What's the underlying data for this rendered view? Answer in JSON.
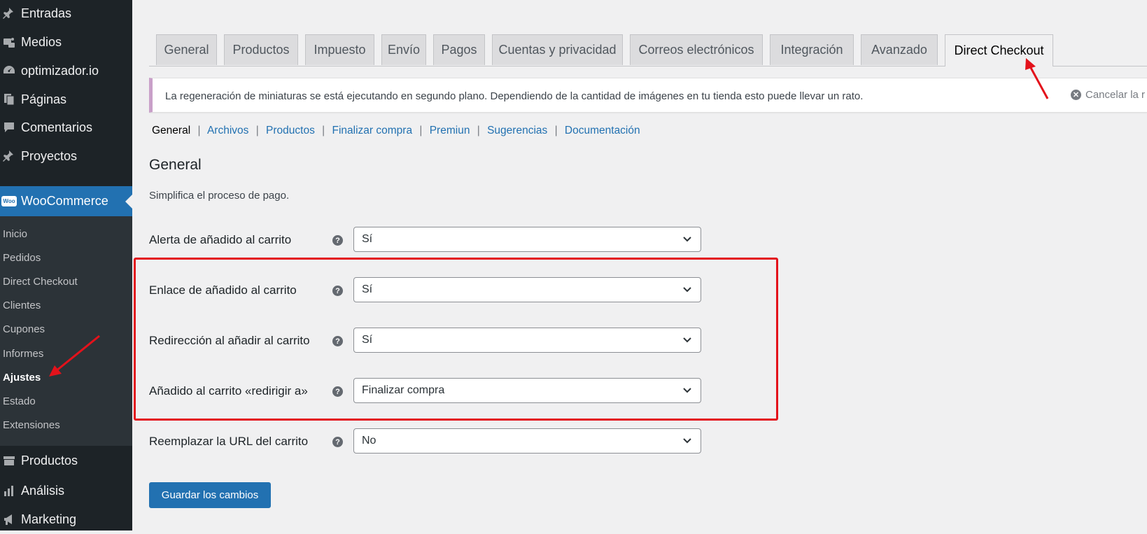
{
  "sidebar": {
    "top_items": [
      {
        "label": "Entradas",
        "icon": "pin-icon"
      },
      {
        "label": "Medios",
        "icon": "media-icon"
      },
      {
        "label": "optimizador.io",
        "icon": "gauge-icon"
      },
      {
        "label": "Páginas",
        "icon": "pages-icon"
      },
      {
        "label": "Comentarios",
        "icon": "comment-icon"
      },
      {
        "label": "Proyectos",
        "icon": "pin-icon"
      }
    ],
    "woocommerce": {
      "label": "WooCommerce",
      "icon_text": "Woo"
    },
    "submenu": [
      "Inicio",
      "Pedidos",
      "Direct Checkout",
      "Clientes",
      "Cupones",
      "Informes",
      "Ajustes",
      "Estado",
      "Extensiones"
    ],
    "submenu_current": "Ajustes",
    "bottom_items": [
      {
        "label": "Productos",
        "icon": "archive-icon"
      },
      {
        "label": "Análisis",
        "icon": "bar-chart-icon"
      },
      {
        "label": "Marketing",
        "icon": "megaphone-icon"
      }
    ]
  },
  "tabs": [
    "General",
    "Productos",
    "Impuesto",
    "Envío",
    "Pagos",
    "Cuentas y privacidad",
    "Correos electrónicos",
    "Integración",
    "Avanzado",
    "Direct Checkout"
  ],
  "active_tab": "Direct Checkout",
  "notice": {
    "message": "La regeneración de miniaturas se está ejecutando en segundo plano. Dependiendo de la cantidad de imágenes en tu tienda esto puede llevar un rato.",
    "cancel": "Cancelar la r"
  },
  "subnav": {
    "current": "General",
    "links": [
      "Archivos",
      "Productos",
      "Finalizar compra",
      "Premiun",
      "Sugerencias",
      "Documentación"
    ]
  },
  "section": {
    "title": "General",
    "description": "Simplifica el proceso de pago."
  },
  "fields": [
    {
      "label": "Alerta de añadido al carrito",
      "value": "Sí"
    },
    {
      "label": "Enlace de añadido al carrito",
      "value": "Sí"
    },
    {
      "label": "Redirección al añadir al carrito",
      "value": "Sí"
    },
    {
      "label": "Añadido al carrito «redirigir a»",
      "value": "Finalizar compra"
    },
    {
      "label": "Reemplazar la URL del carrito",
      "value": "No"
    }
  ],
  "help_glyph": "?",
  "save_button": "Guardar los cambios",
  "colors": {
    "wp_blue": "#2271b1",
    "sidebar_bg": "#1d2327",
    "highlight": "#e3121b"
  }
}
